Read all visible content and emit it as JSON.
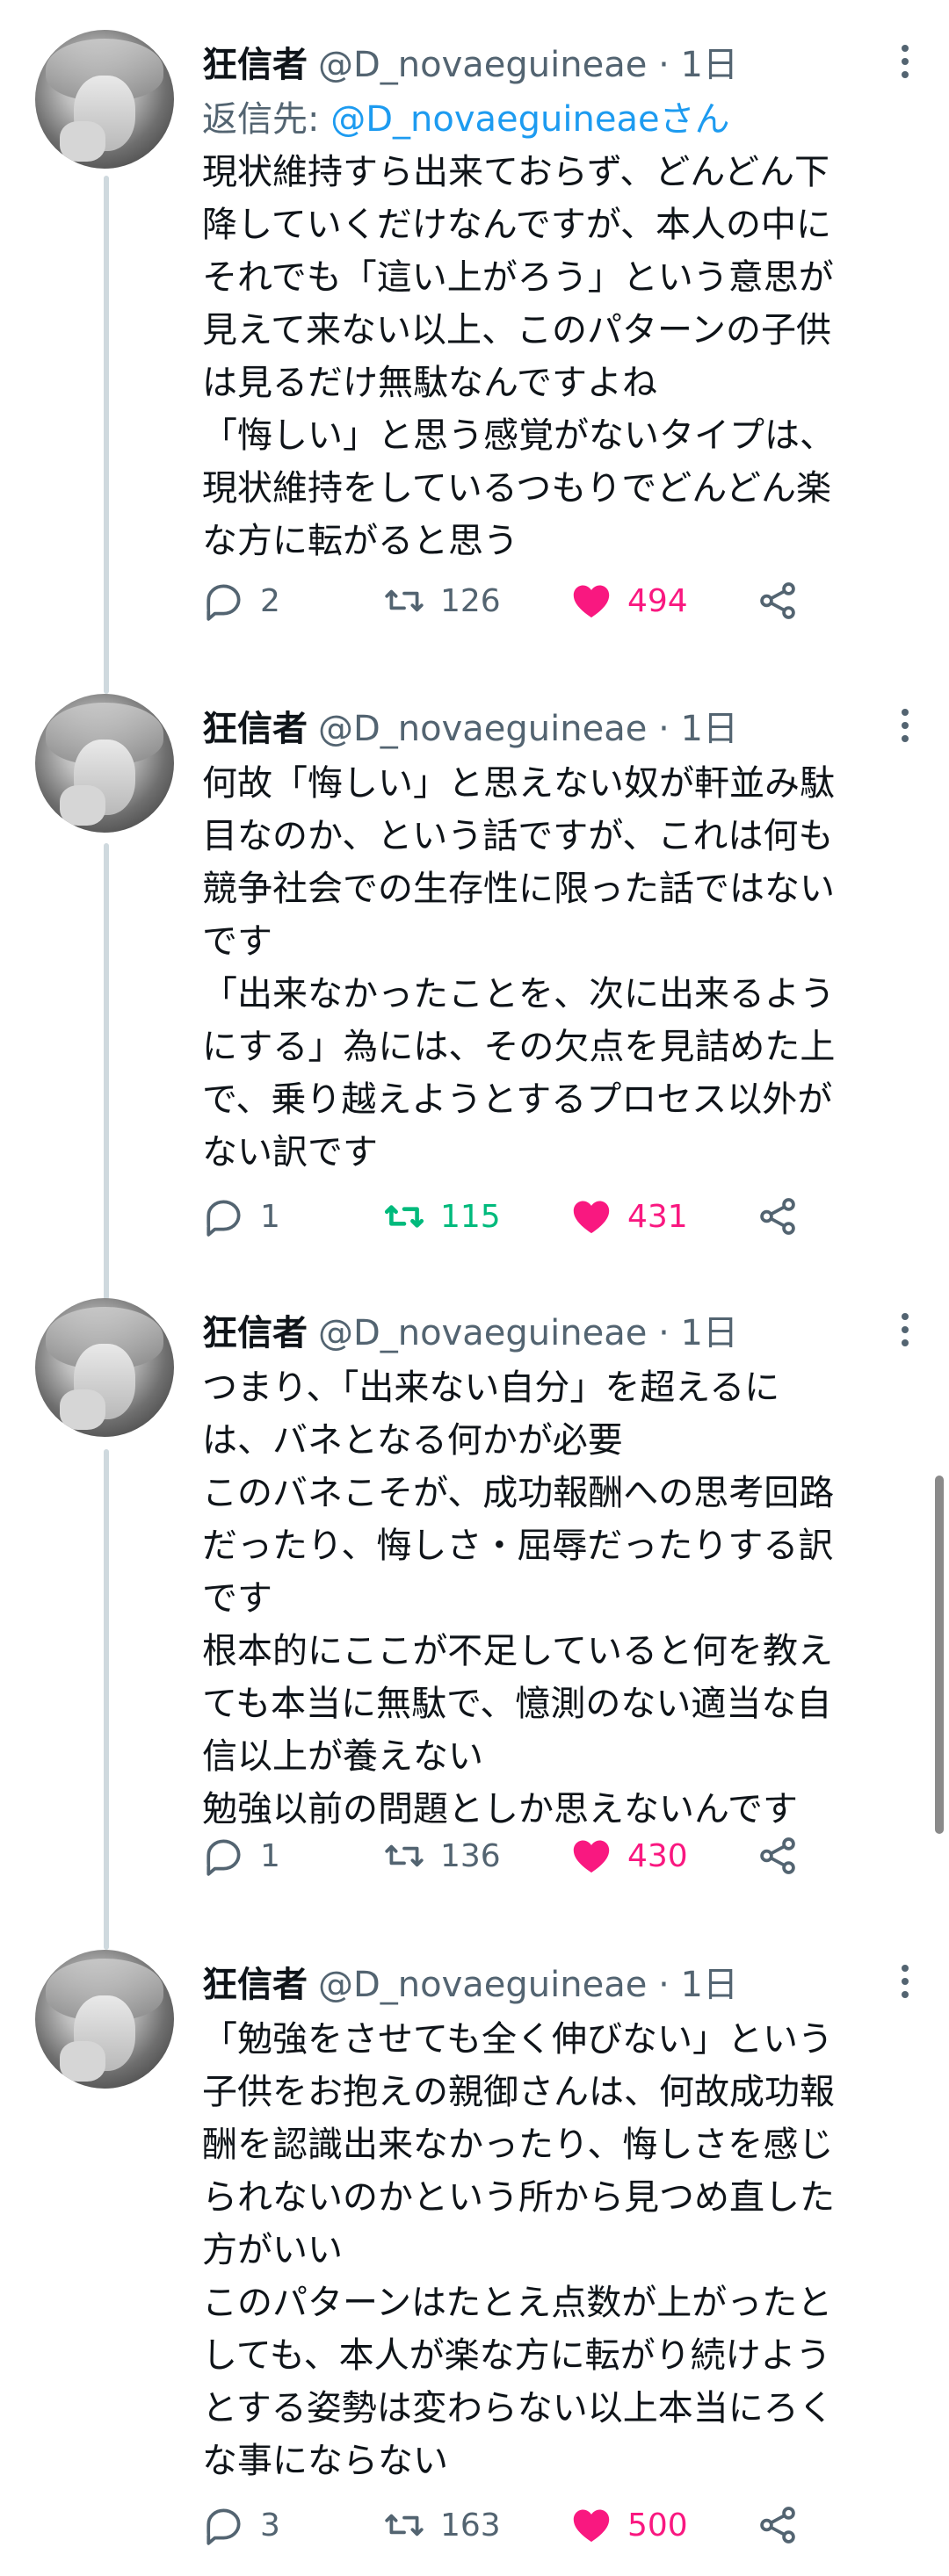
{
  "colors": {
    "retweet_active": "#00ba7c",
    "like_active": "#f91880",
    "muted": "#536471",
    "link": "#1d9bf0"
  },
  "tweets": [
    {
      "name": "狂信者",
      "handle": "@D_novaeguineae · 1日",
      "reply_prefix": "返信先: ",
      "reply_target": "@D_novaeguineaeさん",
      "text": "現状維持すら出来ておらず、どんどん下\n降していくだけなんですが、本人の中に\nそれでも「這い上がろう」という意思が\n見えて来ない以上、このパターンの子供\nは見るだけ無駄なんですよね\n「悔しい」と思う感覚がないタイプは、\n現状維持をしているつもりでどんどん楽\nな方に転がると思う",
      "replies": "2",
      "retweets": "126",
      "likes": "494",
      "retweeted": false,
      "liked": true
    },
    {
      "name": "狂信者",
      "handle": "@D_novaeguineae · 1日",
      "text": "何故「悔しい」と思えない奴が軒並み駄\n目なのか、という話ですが、これは何も\n競争社会での生存性に限った話ではない\nです\n「出来なかったことを、次に出来るよう\nにする」為には、その欠点を見詰めた上\nで、乗り越えようとするプロセス以外が\nない訳です",
      "replies": "1",
      "retweets": "115",
      "likes": "431",
      "retweeted": true,
      "liked": true
    },
    {
      "name": "狂信者",
      "handle": "@D_novaeguineae · 1日",
      "text": "つまり、「出来ない自分」を超えるに\nは、バネとなる何かが必要\nこのバネこそが、成功報酬への思考回路\nだったり、悔しさ・屈辱だったりする訳\nです\n根本的にここが不足していると何を教え\nても本当に無駄で、憶測のない適当な自\n信以上が養えない\n勉強以前の問題としか思えないんです",
      "replies": "1",
      "retweets": "136",
      "likes": "430",
      "retweeted": false,
      "liked": true
    },
    {
      "name": "狂信者",
      "handle": "@D_novaeguineae · 1日",
      "text": "「勉強をさせても全く伸びない」という\n子供をお抱えの親御さんは、何故成功報\n酬を認識出来なかったり、悔しさを感じ\nられないのかという所から見つめ直した\n方がいい\nこのパターンはたとえ点数が上がったと\nしても、本人が楽な方に転がり続けよう\nとする姿勢は変わらない以上本当にろく\nな事にならない",
      "replies": "3",
      "retweets": "163",
      "likes": "500",
      "retweeted": false,
      "liked": true
    }
  ]
}
